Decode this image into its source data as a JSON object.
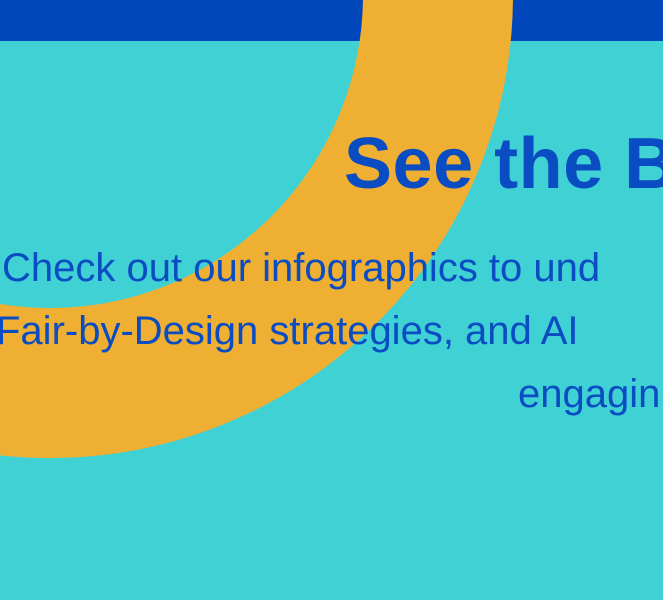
{
  "colors": {
    "background": "#40D1D5",
    "top_bar": "#0047BB",
    "arc": "#EFAF32",
    "text": "#0A4CC2"
  },
  "heading": "See the B",
  "body": {
    "line1": "Check out our infographics to und",
    "line2": "Fair-by-Design strategies, and AI",
    "line3": "engagin"
  }
}
